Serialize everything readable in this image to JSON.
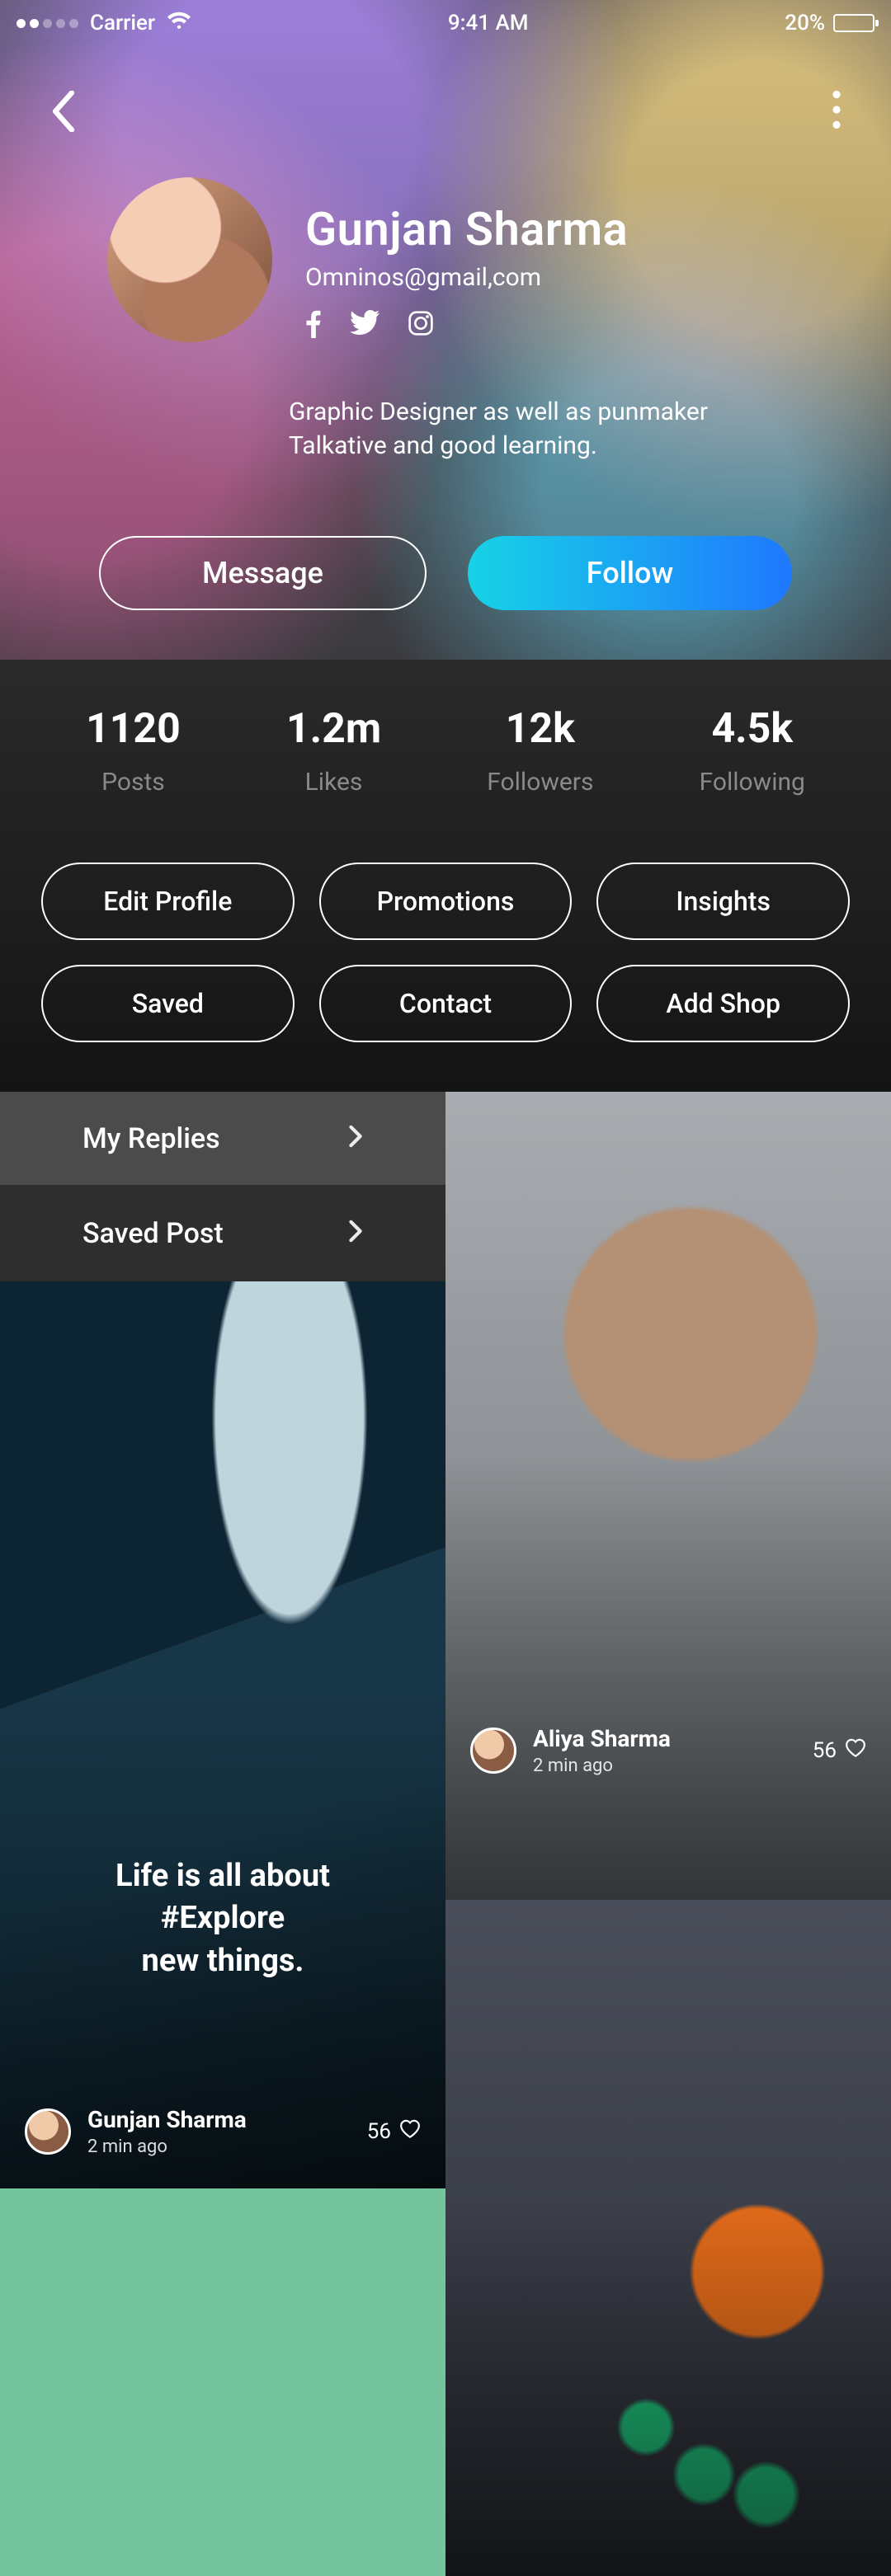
{
  "status": {
    "carrier": "Carrier",
    "time": "9:41 AM",
    "battery": "20%"
  },
  "profile": {
    "name": "Gunjan Sharma",
    "email": "Omninos@gmail,com",
    "bio_line1": "Graphic Designer as well as punmaker",
    "bio_line2": "Talkative and good learning."
  },
  "actions": {
    "message": "Message",
    "follow": "Follow"
  },
  "stats": [
    {
      "value": "1120",
      "label": "Posts"
    },
    {
      "value": "1.2m",
      "label": "Likes"
    },
    {
      "value": "12k",
      "label": "Followers"
    },
    {
      "value": "4.5k",
      "label": "Following"
    }
  ],
  "chips": [
    "Edit Profile",
    "Promotions",
    "Insights",
    "Saved",
    "Contact",
    "Add Shop"
  ],
  "tabs": {
    "replies": "My Replies",
    "saved": "Saved Post"
  },
  "posts": {
    "a": {
      "caption_l1": "Life is all about",
      "caption_l2": "#Explore",
      "caption_l3": "new things.",
      "author": "Gunjan Sharma",
      "time": "2 min ago",
      "likes": "56"
    },
    "b": {
      "author": "Aliya Sharma",
      "time": "2 min ago",
      "likes": "56"
    }
  }
}
